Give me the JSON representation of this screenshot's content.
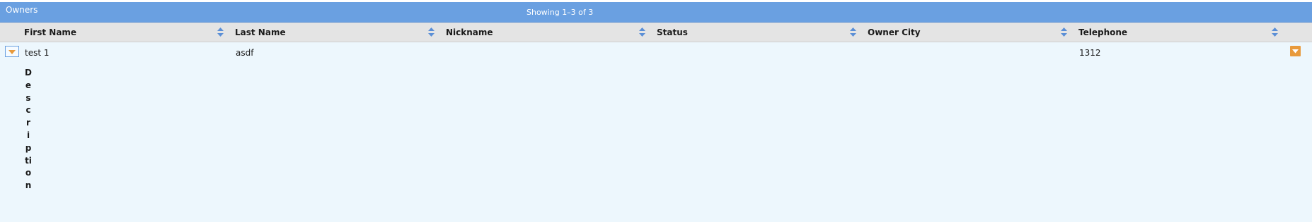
{
  "grid": {
    "title": "Owners",
    "paging_text": "Showing 1–3 of 3"
  },
  "columns": [
    {
      "label": "First Name"
    },
    {
      "label": "Last Name"
    },
    {
      "label": "Nickname"
    },
    {
      "label": "Status"
    },
    {
      "label": "Owner City"
    },
    {
      "label": "Telephone"
    }
  ],
  "rows": [
    {
      "first_name": "test 1",
      "last_name": "asdf",
      "nickname": "",
      "status": "",
      "owner_city": "",
      "telephone": "1312",
      "expanded": true
    }
  ],
  "detail": {
    "label": "Description"
  },
  "colors": {
    "titlebar": "#6aa0e1",
    "header": "#e4e4e4",
    "row_background": "#edf7fd",
    "accent_orange": "#e89a3c"
  },
  "icons": {
    "sort": "sort-arrows-icon",
    "expand": "triangle-down-icon",
    "row_menu": "triangle-down-icon"
  }
}
